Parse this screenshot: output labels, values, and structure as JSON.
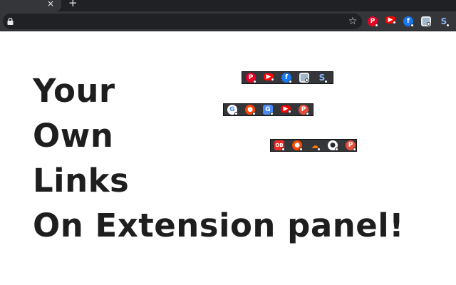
{
  "browser": {
    "tab_close_glyph": "×",
    "new_tab_glyph": "+",
    "star_glyph": "☆",
    "toolbar_extensions": [
      {
        "icon": "pinterest-icon",
        "glyph": "P",
        "style": "pin"
      },
      {
        "icon": "youtube-icon",
        "glyph": "▶",
        "style": "yt"
      },
      {
        "icon": "facebook-icon",
        "glyph": "f",
        "style": "fb"
      },
      {
        "icon": "square-app-icon",
        "glyph": "",
        "style": "sq"
      },
      {
        "icon": "snippet-icon",
        "glyph": "S",
        "style": "sn"
      }
    ]
  },
  "headline": {
    "line1": "Your",
    "line2": "Own",
    "line3": "Links",
    "line4": "On Extension panel!"
  },
  "panels": [
    {
      "name": "panel-1",
      "icons": [
        {
          "icon": "pinterest-icon",
          "glyph": "P",
          "style": "pin"
        },
        {
          "icon": "youtube-icon",
          "glyph": "▶",
          "style": "yt"
        },
        {
          "icon": "facebook-icon",
          "glyph": "f",
          "style": "fb"
        },
        {
          "icon": "square-app-icon",
          "glyph": "",
          "style": "sq"
        },
        {
          "icon": "snippet-icon",
          "glyph": "S",
          "style": "sn"
        }
      ]
    },
    {
      "name": "panel-2",
      "icons": [
        {
          "icon": "google-icon",
          "glyph": "G",
          "style": "goog"
        },
        {
          "icon": "reddit-icon",
          "glyph": "●",
          "style": "red"
        },
        {
          "icon": "translate-icon",
          "glyph": "G",
          "style": "tr"
        },
        {
          "icon": "youtube-icon",
          "glyph": "▶",
          "style": "yt"
        },
        {
          "icon": "pocket-icon",
          "glyph": "P",
          "style": "pc"
        }
      ]
    },
    {
      "name": "panel-3",
      "icons": [
        {
          "icon": "odnoklassniki-icon",
          "glyph": "OB",
          "style": "od"
        },
        {
          "icon": "reddit-icon",
          "glyph": "●",
          "style": "red"
        },
        {
          "icon": "soundcloud-icon",
          "glyph": "☁",
          "style": "sc"
        },
        {
          "icon": "github-icon",
          "glyph": "●",
          "style": "gh"
        },
        {
          "icon": "pocket-icon",
          "glyph": "P",
          "style": "pc"
        }
      ]
    }
  ]
}
